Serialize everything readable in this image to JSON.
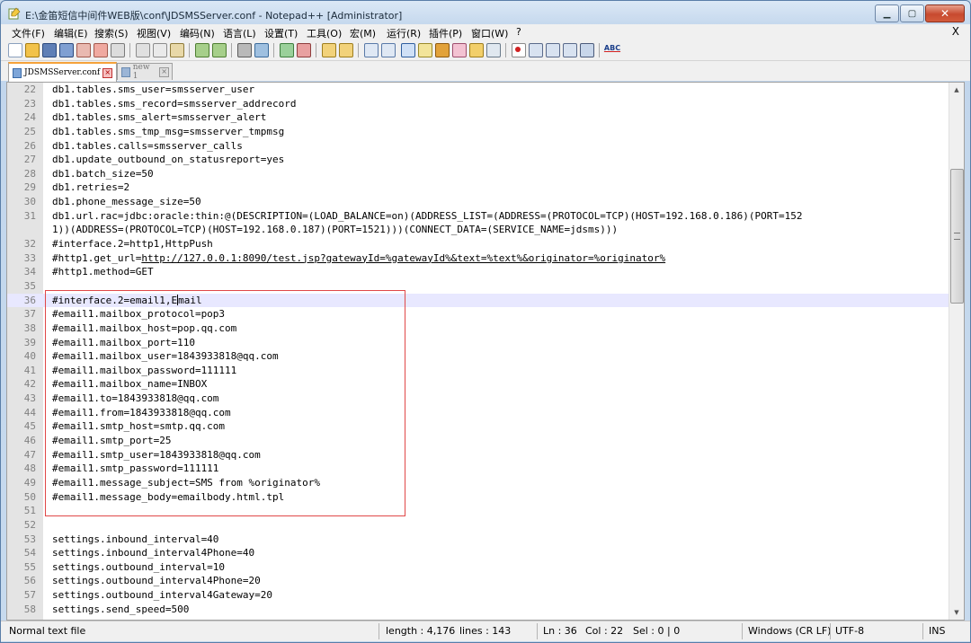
{
  "window": {
    "title": "E:\\金笛短信中间件WEB版\\conf\\JDSMSServer.conf - Notepad++ [Administrator]",
    "min_glyph": "▁",
    "max_glyph": "▢",
    "close_glyph": "✕"
  },
  "menu": {
    "items": [
      "文件(F)",
      "编辑(E)",
      "搜索(S)",
      "视图(V)",
      "编码(N)",
      "语言(L)",
      "设置(T)",
      "工具(O)",
      "宏(M)",
      "运行(R)",
      "插件(P)",
      "窗口(W)",
      "?"
    ],
    "close_label": "X"
  },
  "toolbar": {
    "abc_label": "ABC"
  },
  "tabs": [
    {
      "label": "JDSMSServer.conf",
      "active": true
    },
    {
      "label": "new 1",
      "active": false
    }
  ],
  "editor": {
    "current_line": 36,
    "lines": [
      {
        "n": "22",
        "text": "db1.tables.sms_user=smsserver_user"
      },
      {
        "n": "23",
        "text": "db1.tables.sms_record=smsserver_addrecord"
      },
      {
        "n": "24",
        "text": "db1.tables.sms_alert=smsserver_alert"
      },
      {
        "n": "25",
        "text": "db1.tables.sms_tmp_msg=smsserver_tmpmsg"
      },
      {
        "n": "26",
        "text": "db1.tables.calls=smsserver_calls"
      },
      {
        "n": "27",
        "text": "db1.update_outbound_on_statusreport=yes"
      },
      {
        "n": "28",
        "text": "db1.batch_size=50"
      },
      {
        "n": "29",
        "text": "db1.retries=2"
      },
      {
        "n": "30",
        "text": "db1.phone_message_size=50"
      },
      {
        "n": "31",
        "text": "db1.url.rac=jdbc:oracle:thin:@(DESCRIPTION=(LOAD_BALANCE=on)(ADDRESS_LIST=(ADDRESS=(PROTOCOL=TCP)(HOST=192.168.0.186)(PORT=152"
      },
      {
        "n": "",
        "text": "1))(ADDRESS=(PROTOCOL=TCP)(HOST=192.168.0.187)(PORT=1521)))(CONNECT_DATA=(SERVICE_NAME=jdsms)))"
      },
      {
        "n": "32",
        "text": "#interface.2=http1,HttpPush"
      },
      {
        "n": "33",
        "text": "#http1.get_url=",
        "url": "http://127.0.0.1:8090/test.jsp?gatewayId=%gatewayId%&text=%text%&originator=%originator%"
      },
      {
        "n": "34",
        "text": "#http1.method=GET"
      },
      {
        "n": "35",
        "text": ""
      },
      {
        "n": "36",
        "text": "#interface.2=email1,E",
        "after_caret": "mail"
      },
      {
        "n": "37",
        "text": "#email1.mailbox_protocol=pop3"
      },
      {
        "n": "38",
        "text": "#email1.mailbox_host=pop.qq.com"
      },
      {
        "n": "39",
        "text": "#email1.mailbox_port=110"
      },
      {
        "n": "40",
        "text": "#email1.mailbox_user=1843933818@qq.com"
      },
      {
        "n": "41",
        "text": "#email1.mailbox_password=111111"
      },
      {
        "n": "42",
        "text": "#email1.mailbox_name=INBOX"
      },
      {
        "n": "43",
        "text": "#email1.to=1843933818@qq.com"
      },
      {
        "n": "44",
        "text": "#email1.from=1843933818@qq.com"
      },
      {
        "n": "45",
        "text": "#email1.smtp_host=smtp.qq.com"
      },
      {
        "n": "46",
        "text": "#email1.smtp_port=25"
      },
      {
        "n": "47",
        "text": "#email1.smtp_user=1843933818@qq.com"
      },
      {
        "n": "48",
        "text": "#email1.smtp_password=111111"
      },
      {
        "n": "49",
        "text": "#email1.message_subject=SMS from %originator%"
      },
      {
        "n": "50",
        "text": "#email1.message_body=emailbody.html.tpl"
      },
      {
        "n": "51",
        "text": ""
      },
      {
        "n": "52",
        "text": ""
      },
      {
        "n": "53",
        "text": "settings.inbound_interval=40"
      },
      {
        "n": "54",
        "text": "settings.inbound_interval4Phone=40"
      },
      {
        "n": "55",
        "text": "settings.outbound_interval=10"
      },
      {
        "n": "56",
        "text": "settings.outbound_interval4Phone=20"
      },
      {
        "n": "57",
        "text": "settings.outbound_interval4Gateway=20"
      },
      {
        "n": "58",
        "text": "settings.send_speed=500"
      }
    ]
  },
  "scrollbar": {
    "up_glyph": "▲",
    "down_glyph": "▼"
  },
  "status": {
    "file_type": "Normal text file",
    "length": "length : 4,176",
    "lines": "lines : 143",
    "ln": "Ln : 36",
    "col": "Col : 22",
    "sel": "Sel : 0 | 0",
    "eol": "Windows (CR LF)",
    "encoding": "UTF-8",
    "mode": "INS"
  },
  "colors": {
    "highlight_box": "#e04848",
    "current_line": "#e8e8ff",
    "active_tab_accent": "#f5a23a"
  }
}
